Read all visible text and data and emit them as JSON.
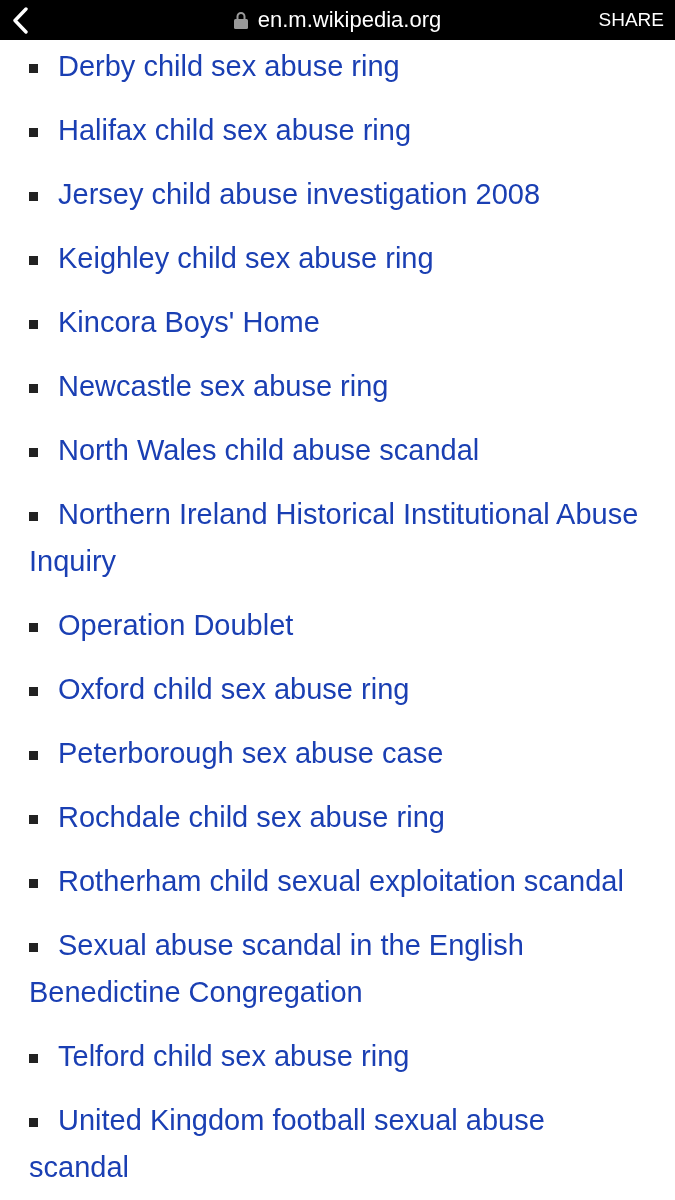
{
  "browser_bar": {
    "url": "en.m.wikipedia.org",
    "share_label": "SHARE"
  },
  "links": [
    {
      "text": "Derby child sex abuse ring"
    },
    {
      "text": "Halifax child sex abuse ring"
    },
    {
      "text": "Jersey child abuse investigation 2008"
    },
    {
      "text": "Keighley child sex abuse ring"
    },
    {
      "text": "Kincora Boys' Home"
    },
    {
      "text": "Newcastle sex abuse ring"
    },
    {
      "text": "North Wales child abuse scandal"
    },
    {
      "text": "Northern Ireland Historical Institutional Abuse Inquiry"
    },
    {
      "text": "Operation Doublet"
    },
    {
      "text": "Oxford child sex abuse ring"
    },
    {
      "text": "Peterborough sex abuse case"
    },
    {
      "text": "Rochdale child sex abuse ring"
    },
    {
      "text": "Rotherham child sexual exploitation scandal"
    },
    {
      "text": "Sexual abuse scandal in the English Benedictine Congregation"
    },
    {
      "text": "Telford child sex abuse ring"
    },
    {
      "text": "United Kingdom football sexual abuse scandal"
    }
  ]
}
